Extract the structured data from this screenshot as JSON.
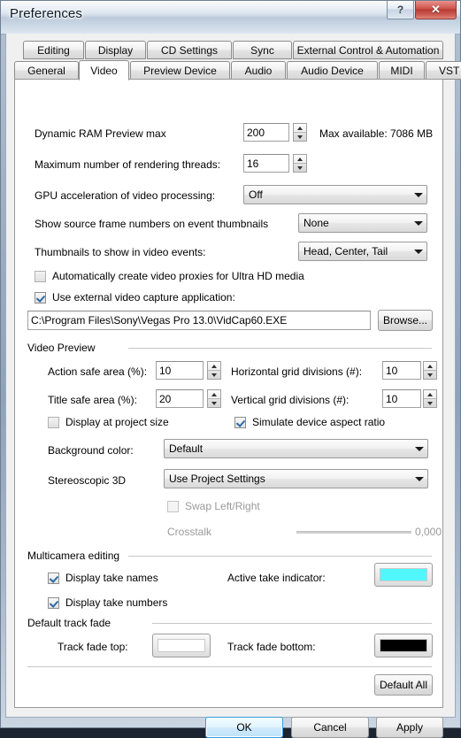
{
  "window": {
    "title": "Preferences",
    "help_button": "?",
    "close_button": "✕"
  },
  "tabs": {
    "row1": [
      {
        "label": "Editing",
        "selected": false
      },
      {
        "label": "Display",
        "selected": false
      },
      {
        "label": "CD Settings",
        "selected": false
      },
      {
        "label": "Sync",
        "selected": false
      },
      {
        "label": "External Control & Automation",
        "selected": false
      }
    ],
    "row2": [
      {
        "label": "General",
        "selected": false
      },
      {
        "label": "Video",
        "selected": true
      },
      {
        "label": "Preview Device",
        "selected": false
      },
      {
        "label": "Audio",
        "selected": false
      },
      {
        "label": "Audio Device",
        "selected": false
      },
      {
        "label": "MIDI",
        "selected": false
      },
      {
        "label": "VST Effects",
        "selected": false
      }
    ]
  },
  "video": {
    "dynamic_ram_label": "Dynamic RAM Preview max",
    "dynamic_ram_value": "200",
    "max_available": "Max available: 7086 MB",
    "render_threads_label": "Maximum number of rendering threads:",
    "render_threads_value": "16",
    "gpu_label": "GPU acceleration of video processing:",
    "gpu_value": "Off",
    "source_frame_label": "Show source frame numbers on event thumbnails",
    "source_frame_value": "None",
    "thumbnails_label": "Thumbnails to show in video events:",
    "thumbnails_value": "Head, Center, Tail",
    "auto_proxy_label": "Automatically create video proxies for Ultra HD media",
    "auto_proxy_checked": false,
    "ext_capture_label": "Use external video capture application:",
    "ext_capture_checked": true,
    "capture_path": "C:\\Program Files\\Sony\\Vegas Pro 13.0\\VidCap60.EXE",
    "browse_label": "Browse..."
  },
  "preview": {
    "group_label": "Video Preview",
    "action_safe_label": "Action safe area (%):",
    "action_safe_value": "10",
    "title_safe_label": "Title safe area (%):",
    "title_safe_value": "20",
    "hgrid_label": "Horizontal grid divisions (#):",
    "hgrid_value": "10",
    "vgrid_label": "Vertical grid divisions (#):",
    "vgrid_value": "10",
    "display_project_size_label": "Display at project size",
    "display_project_size_checked": false,
    "simulate_aspect_label": "Simulate device aspect ratio",
    "simulate_aspect_checked": true,
    "bgcolor_label": "Background color:",
    "bgcolor_value": "Default",
    "stereo_label": "Stereoscopic 3D",
    "stereo_value": "Use Project Settings",
    "swap_lr_label": "Swap Left/Right",
    "swap_lr_checked": false,
    "crosstalk_label": "Crosstalk",
    "crosstalk_value": "0,000"
  },
  "multicam": {
    "group_label": "Multicamera editing",
    "take_names_label": "Display take names",
    "take_names_checked": true,
    "take_numbers_label": "Display take numbers",
    "take_numbers_checked": true,
    "active_take_label": "Active take indicator:",
    "active_take_color": "#50F7FF"
  },
  "track_fade": {
    "group_label": "Default track fade",
    "top_label": "Track fade top:",
    "top_color": "#FFFFFF",
    "bottom_label": "Track fade bottom:",
    "bottom_color": "#000000"
  },
  "buttons": {
    "default_all": "Default All",
    "ok": "OK",
    "cancel": "Cancel",
    "apply": "Apply"
  }
}
